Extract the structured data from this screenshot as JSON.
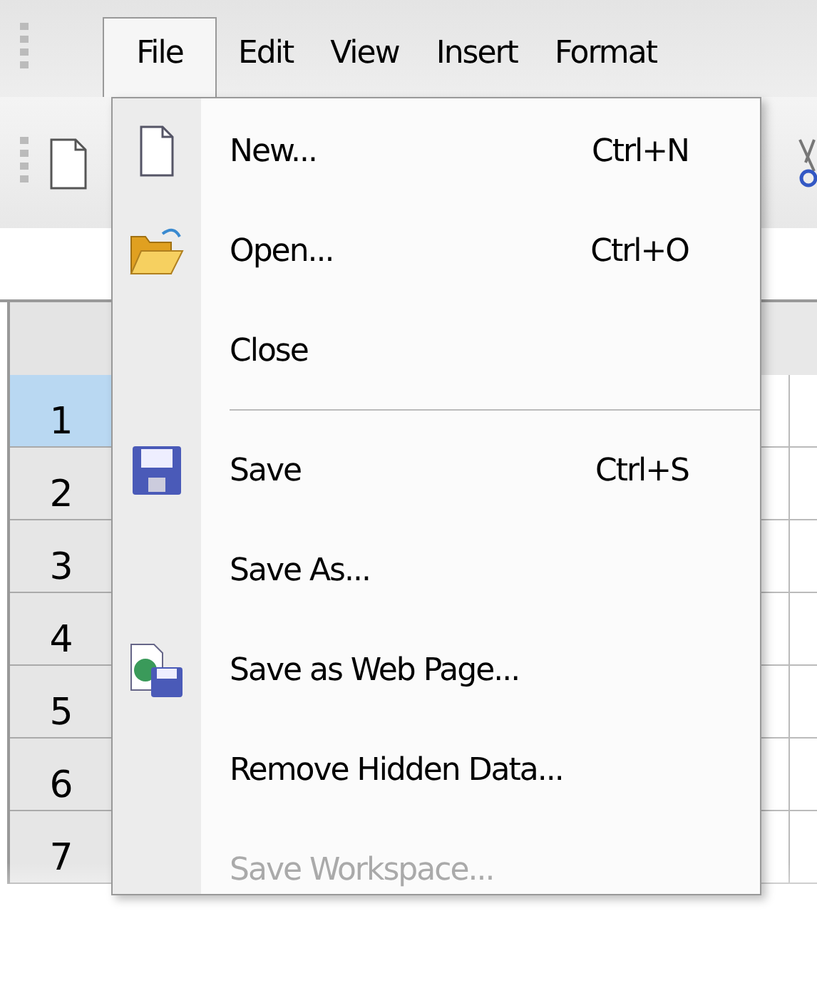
{
  "menu_bar": [
    {
      "label": "File",
      "selected": true
    },
    {
      "label": "Edit",
      "selected": false
    },
    {
      "label": "View",
      "selected": false
    },
    {
      "label": "Insert",
      "selected": false
    },
    {
      "label": "Format",
      "selected": false
    }
  ],
  "row_headers": [
    {
      "label": "1",
      "selected": true
    },
    {
      "label": "2",
      "selected": false
    },
    {
      "label": "3",
      "selected": false
    },
    {
      "label": "4",
      "selected": false
    },
    {
      "label": "5",
      "selected": false
    },
    {
      "label": "6",
      "selected": false
    },
    {
      "label": "7",
      "selected": false
    }
  ],
  "file_menu": [
    {
      "kind": "item",
      "label": "New...",
      "shortcut": "Ctrl+N",
      "disabled": false
    },
    {
      "kind": "item",
      "label": "Open...",
      "shortcut": "Ctrl+O",
      "disabled": false
    },
    {
      "kind": "item",
      "label": "Close",
      "disabled": false
    },
    {
      "kind": "separator"
    },
    {
      "kind": "item",
      "label": "Save",
      "shortcut": "Ctrl+S",
      "disabled": false
    },
    {
      "kind": "item",
      "label": "Save As...",
      "disabled": false
    },
    {
      "kind": "item",
      "label": "Save as Web Page...",
      "disabled": false
    },
    {
      "kind": "item",
      "label": "Remove Hidden Data...",
      "disabled": false
    },
    {
      "kind": "item",
      "label": "Save Workspace...",
      "disabled": true
    }
  ]
}
